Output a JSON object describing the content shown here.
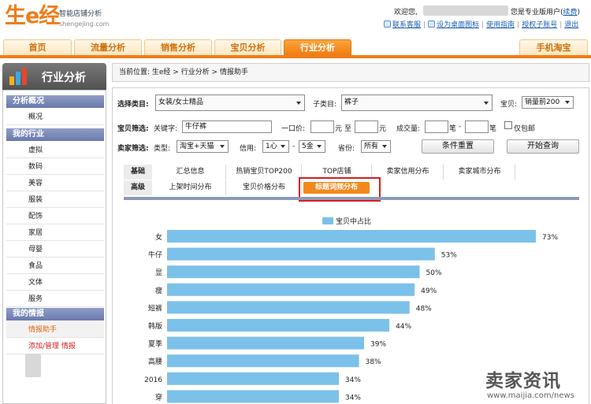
{
  "brand": {
    "logo": "生e经",
    "slogan": "智能店铺分析",
    "domain": "shengejing.com"
  },
  "user": {
    "welcome": "欢迎您,",
    "pro_text": "您是专业版用户",
    "renew_link": "续费"
  },
  "toplinks": [
    "联系客服",
    "设为桌面图标",
    "使用指南",
    "授权子账号",
    "退出"
  ],
  "nav": {
    "tabs": [
      "首页",
      "流量分析",
      "销售分析",
      "宝贝分析",
      "行业分析"
    ],
    "active": "行业分析",
    "right_tab": "手机淘宝"
  },
  "sidebar": {
    "title": "行业分析",
    "sections": [
      {
        "title": "分析概况",
        "items": [
          "概况"
        ]
      },
      {
        "title": "我的行业",
        "items": [
          "虚拟",
          "数码",
          "美容",
          "服装",
          "配饰",
          "家居",
          "母婴",
          "食品",
          "文体",
          "服务"
        ]
      },
      {
        "title": "我的情报",
        "items": [
          "情报助手",
          "添加/管理 情报"
        ]
      }
    ]
  },
  "breadcrumb": "当前位置: 生e经 > 行业分析 > 情报助手",
  "filters": {
    "category_label": "选择类目:",
    "category_value": "女装/女士精品",
    "subcategory_label": "子类目:",
    "subcategory_value": "裤子",
    "item_label": "宝贝:",
    "item_value": "销量前200",
    "item_filter_label": "宝贝筛选:",
    "keyword_label": "关键字:",
    "keyword_value": "牛仔裤",
    "price_label": "一口价:",
    "price_unit": "元",
    "price_to": "至",
    "volume_label": "成交量:",
    "volume_unit": "笔",
    "volume_dash": "-",
    "freeship_label": "仅包邮",
    "seller_filter_label": "卖家筛选:",
    "type_label": "类型:",
    "type_value": "淘宝+天猫",
    "credit_label": "信用:",
    "credit_min": "1心",
    "credit_dash": "-",
    "credit_max": "5金",
    "province_label": "省份:",
    "province_value": "所有",
    "reset_button": "条件重置",
    "query_button": "开始查询"
  },
  "subtabs": {
    "row1_header": "基础",
    "row1": [
      "汇总信息",
      "热销宝贝TOP200",
      "TOP店铺",
      "卖家信用分布",
      "卖家城市分布"
    ],
    "row2_header": "高级",
    "row2": [
      "上架时间分布",
      "宝贝价格分布",
      "标题词频分布"
    ],
    "active": "标题词频分布"
  },
  "chart_data": {
    "type": "bar",
    "orientation": "horizontal",
    "series": [
      {
        "name": "宝贝中占比",
        "color": "#7cc1ea"
      }
    ],
    "categories": [
      "女",
      "牛仔",
      "显",
      "瘦",
      "短裤",
      "韩版",
      "夏季",
      "高腰",
      "2016",
      "穿"
    ],
    "values": [
      73,
      53,
      50,
      49,
      48,
      44,
      39,
      38,
      34,
      34
    ],
    "value_labels": [
      "73%",
      "53%",
      "50%",
      "49%",
      "48%",
      "44%",
      "39%",
      "38%",
      "34%",
      "34%"
    ],
    "value_unit": "%",
    "xlim": [
      0,
      100
    ],
    "grid": false,
    "legend": "top-center"
  },
  "watermark": {
    "title": "卖家资讯",
    "url": "www.maijia.com/news"
  }
}
